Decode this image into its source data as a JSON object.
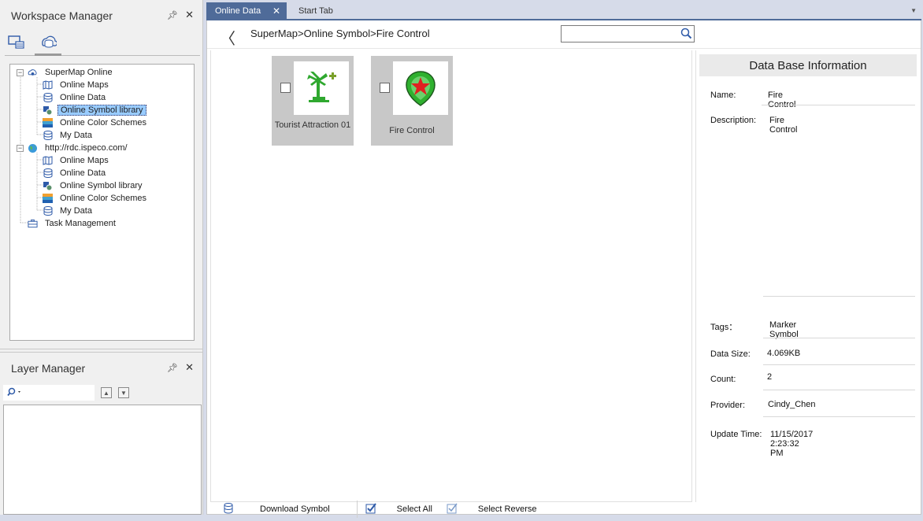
{
  "workspace": {
    "title": "Workspace Manager",
    "tree": [
      {
        "label": "SuperMap Online",
        "icon": "cloud-icon",
        "level": 0
      },
      {
        "label": "Online Maps",
        "icon": "map-icon",
        "level": 1
      },
      {
        "label": "Online Data",
        "icon": "database-icon",
        "level": 1
      },
      {
        "label": "Online Symbol library",
        "icon": "symbol-library-icon",
        "level": 1,
        "selected": true
      },
      {
        "label": "Online Color Schemes",
        "icon": "color-scheme-icon",
        "level": 1
      },
      {
        "label": "My Data",
        "icon": "database-icon",
        "level": 1
      },
      {
        "label": "http://rdc.ispeco.com/",
        "icon": "globe-icon",
        "level": 0
      },
      {
        "label": "Online Maps",
        "icon": "map-icon",
        "level": 1
      },
      {
        "label": "Online Data",
        "icon": "database-icon",
        "level": 1
      },
      {
        "label": "Online Symbol library",
        "icon": "symbol-library-icon",
        "level": 1
      },
      {
        "label": "Online Color Schemes",
        "icon": "color-scheme-icon",
        "level": 1
      },
      {
        "label": "My Data",
        "icon": "database-icon",
        "level": 1
      },
      {
        "label": "Task Management",
        "icon": "toolbox-icon",
        "level": 0
      }
    ]
  },
  "layer": {
    "title": "Layer Manager"
  },
  "tabs": [
    {
      "label": "Online Data",
      "active": true
    },
    {
      "label": "Start Tab",
      "active": false
    }
  ],
  "nav": {
    "breadcrumb": "SuperMap>Online Symbol>Fire Control",
    "search_value": ""
  },
  "symbols": [
    {
      "name": "Tourist Attraction 01",
      "icon": "palm-tree-icon"
    },
    {
      "name": "Fire Control",
      "icon": "fire-shield-icon"
    }
  ],
  "actions": {
    "download": "Download Symbol",
    "select_all": "Select All",
    "select_reverse": "Select Reverse"
  },
  "info": {
    "title": "Data Base Information",
    "name_label": "Name:",
    "name_value": "Fire Control",
    "description_label": "Description:",
    "description_value": "Fire Control",
    "tags_label": "Tags：",
    "tags_value": "Marker Symbol",
    "size_label": "Data Size:",
    "size_value": "4.069KB",
    "count_label": "Count:",
    "count_value": "2",
    "provider_label": "Provider:",
    "provider_value": "Cindy_Chen",
    "update_label": "Update Time:",
    "update_value": "11/15/2017 2:23:32 PM"
  },
  "colors": {
    "accent": "#4f6b99",
    "selection": "#99ccff"
  }
}
